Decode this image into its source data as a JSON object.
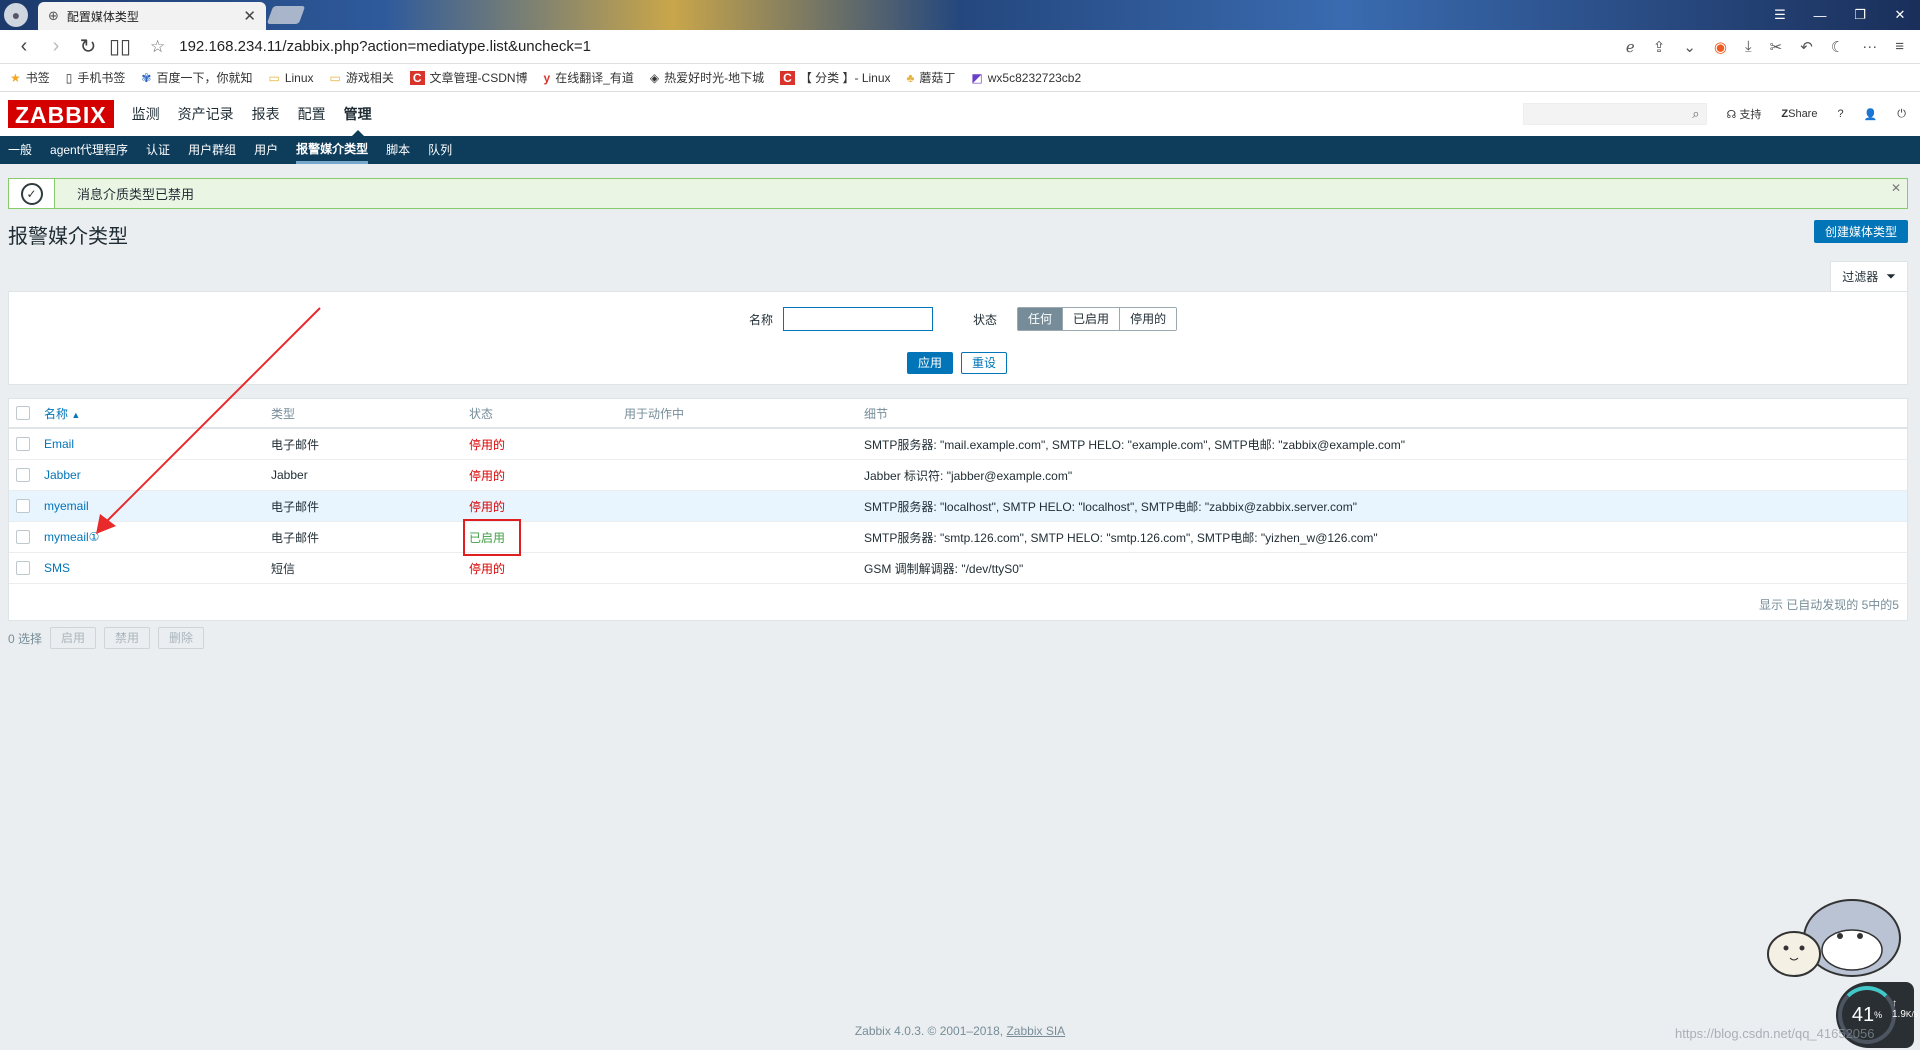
{
  "browser": {
    "tab_title": "配置媒体类型",
    "url": "192.168.234.11/zabbix.php?action=mediatype.list&uncheck=1",
    "bookmarks": [
      {
        "icon": "star-icon",
        "label": "书签"
      },
      {
        "icon": "page-icon",
        "label": "手机书签"
      },
      {
        "icon": "paw-icon",
        "label": "百度一下，你就知"
      },
      {
        "icon": "folder-icon",
        "label": "Linux"
      },
      {
        "icon": "folder-icon",
        "label": "游戏相关"
      },
      {
        "icon": "csdn-icon",
        "label": "文章管理-CSDN博"
      },
      {
        "icon": "youdao-icon",
        "label": "在线翻译_有道"
      },
      {
        "icon": "mask-icon",
        "label": "热爱好时光-地下城"
      },
      {
        "icon": "csdn-icon",
        "label": "【 分类 】- Linux"
      },
      {
        "icon": "mushroom-icon",
        "label": "蘑菇丁"
      },
      {
        "icon": "blog-icon",
        "label": "wx5c8232723cb2"
      }
    ]
  },
  "zabbix": {
    "logo": "ZABBIX",
    "top_menu": [
      "监测",
      "资产记录",
      "报表",
      "配置",
      "管理"
    ],
    "header_links": {
      "support": "支持",
      "share": "Share",
      "help": "?"
    },
    "sub_menu": [
      "一般",
      "agent代理程序",
      "认证",
      "用户群组",
      "用户",
      "报警媒介类型",
      "脚本",
      "队列"
    ],
    "message": "消息介质类型已禁用",
    "page_title": "报警媒介类型",
    "create_button": "创建媒体类型",
    "filter": {
      "tab_label": "过滤器",
      "name_label": "名称",
      "name_value": "",
      "status_label": "状态",
      "status_options": [
        "任何",
        "已启用",
        "停用的"
      ],
      "apply": "应用",
      "reset": "重设"
    },
    "table": {
      "headers": {
        "name": "名称",
        "type": "类型",
        "status": "状态",
        "used": "用于动作中",
        "details": "细节"
      },
      "rows": [
        {
          "name": "Email",
          "type": "电子邮件",
          "status": "停用的",
          "details": "SMTP服务器: \"mail.example.com\", SMTP HELO: \"example.com\", SMTP电邮: \"zabbix@example.com\""
        },
        {
          "name": "Jabber",
          "type": "Jabber",
          "status": "停用的",
          "details": "Jabber 标识符: \"jabber@example.com\""
        },
        {
          "name": "myemail",
          "type": "电子邮件",
          "status": "停用的",
          "details": "SMTP服务器: \"localhost\", SMTP HELO: \"localhost\", SMTP电邮: \"zabbix@zabbix.server.com\""
        },
        {
          "name": "mymeail①",
          "type": "电子邮件",
          "status": "已启用",
          "details": "SMTP服务器: \"smtp.126.com\", SMTP HELO: \"smtp.126.com\", SMTP电邮: \"yizhen_w@126.com\""
        },
        {
          "name": "SMS",
          "type": "短信",
          "status": "停用的",
          "details": "GSM 调制解调器: \"/dev/ttyS0\""
        }
      ],
      "footer": "显示 已自动发现的 5中的5"
    },
    "bulk": {
      "selected": "0 选择",
      "enable": "启用",
      "disable": "禁用",
      "delete": "删除"
    },
    "footer": {
      "text": "Zabbix 4.0.3. © 2001–2018,",
      "link": "Zabbix SIA"
    }
  },
  "overlay": {
    "speed_percent": "41",
    "speed_unit": "%",
    "rate": "1.9",
    "rate_unit": "K/s",
    "watermark": "https://blog.csdn.net/qq_41652056"
  },
  "colors": {
    "accent": "#0275b8",
    "nav": "#0e3d5c",
    "disabled": "#dc0000",
    "enabled": "#429e47",
    "logo": "#d40000"
  }
}
